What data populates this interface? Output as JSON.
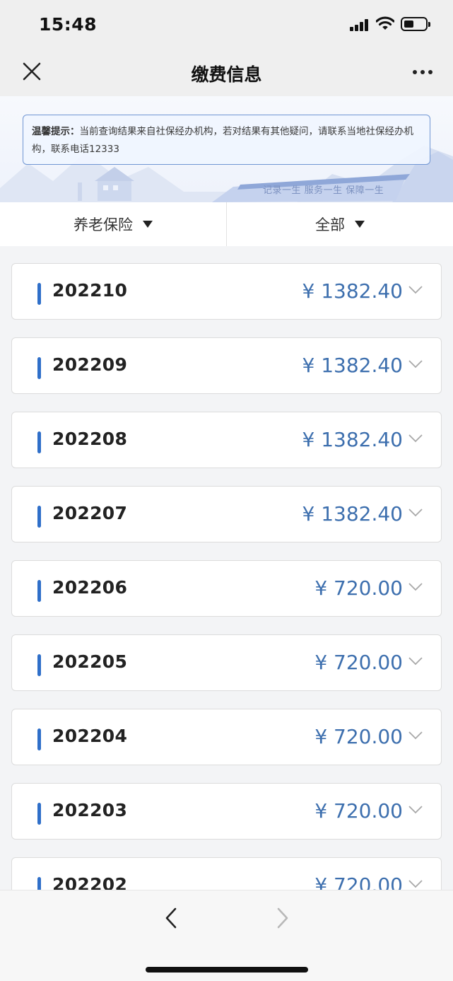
{
  "status_bar": {
    "time": "15:48"
  },
  "nav": {
    "title": "缴费信息"
  },
  "notice": {
    "label": "温馨提示：",
    "text": "当前查询结果来自社保经办机构，若对结果有其他疑问，请联系当地社保经办机构，联系电话12333"
  },
  "banner": {
    "slogan": "记录一生 服务一生 保障一生"
  },
  "filters": {
    "insurance_type": "养老保险",
    "scope": "全部"
  },
  "records": [
    {
      "period": "202210",
      "amount": "¥ 1382.40"
    },
    {
      "period": "202209",
      "amount": "¥ 1382.40"
    },
    {
      "period": "202208",
      "amount": "¥ 1382.40"
    },
    {
      "period": "202207",
      "amount": "¥ 1382.40"
    },
    {
      "period": "202206",
      "amount": "¥ 720.00"
    },
    {
      "period": "202205",
      "amount": "¥ 720.00"
    },
    {
      "period": "202204",
      "amount": "¥ 720.00"
    },
    {
      "period": "202203",
      "amount": "¥ 720.00"
    },
    {
      "period": "202202",
      "amount": "¥ 720.00"
    }
  ],
  "colors": {
    "accent": "#2f6fc9",
    "amount": "#3d6fae",
    "notice_border": "#6f95d3"
  },
  "icons": {
    "close": "close-icon",
    "more": "more-icon",
    "dropdown": "triangle-down-icon",
    "expand": "chevron-down-icon",
    "back": "chevron-left-icon",
    "forward": "chevron-right-icon"
  }
}
